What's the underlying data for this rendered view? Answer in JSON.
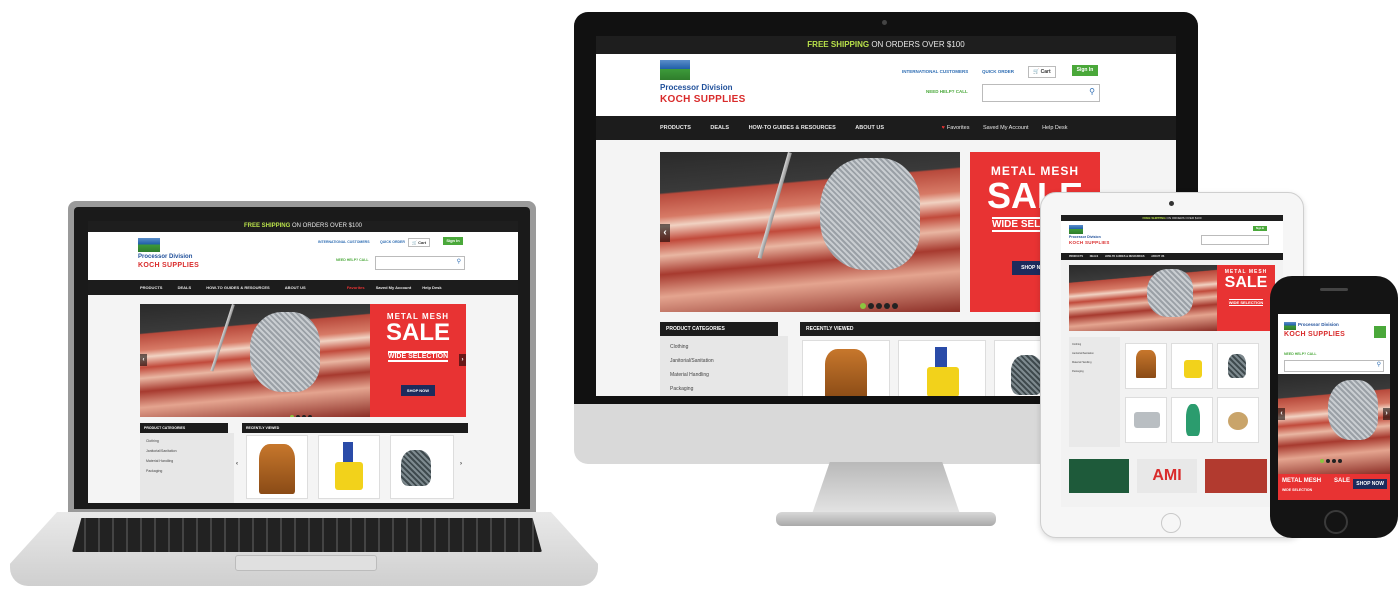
{
  "site": {
    "shipping_banner": {
      "highlight": "FREE SHIPPING",
      "rest": "ON ORDERS OVER $100"
    },
    "logo": {
      "line1": "Processor Division",
      "line2": "KOCH SUPPLIES"
    },
    "header_links": {
      "international": "INTERNATIONAL CUSTOMERS",
      "quick_order": "QUICK ORDER",
      "cart": "Cart",
      "sign_in": "Sign In"
    },
    "phone_label": "NEED HELP? CALL",
    "nav": [
      "PRODUCTS",
      "DEALS",
      "HOW-TO GUIDES & RESOURCES",
      "ABOUT US"
    ],
    "nav_right": [
      "Favorites",
      "Saved My Account",
      "Help Desk"
    ],
    "promo": {
      "line1": "METAL MESH",
      "line2": "SALE",
      "line3": "WIDE SELECTION",
      "cta": "SHOP NOW"
    },
    "panels": {
      "categories": "PRODUCT CATEGORIES",
      "recent": "RECENTLY VIEWED"
    },
    "categories": [
      "Clothing",
      "Janitorial/Sanitation",
      "Material Handling",
      "Packaging"
    ],
    "colors": {
      "nav": "#1c1c1c",
      "promo": "#e83333",
      "accent_green": "#8bc53f",
      "logo_blue": "#1f4f9a",
      "logo_red": "#d92b2b"
    }
  },
  "icons": {
    "search": "search-icon",
    "cart": "cart-icon",
    "heart": "heart-icon",
    "prev": "chevron-left-icon",
    "next": "chevron-right-icon"
  }
}
